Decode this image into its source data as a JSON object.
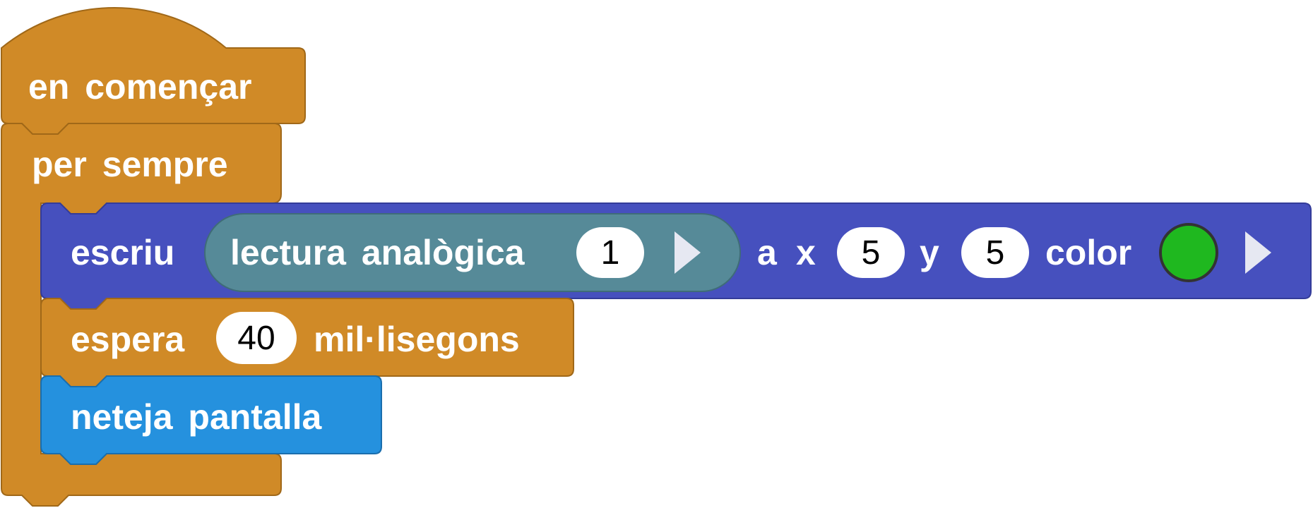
{
  "colors": {
    "event": "#D08A27",
    "event_stroke": "#A06818",
    "display": "#4650BE",
    "display_stroke": "#343C99",
    "analog": "#568A98",
    "analog_stroke": "#3F6C78",
    "clear": "#2591DE",
    "clear_stroke": "#1A6EAD",
    "color_value": "#1FB81F",
    "arrow": "#E6E8F2"
  },
  "blocks": {
    "on_start": {
      "label": "en començar"
    },
    "forever": {
      "label": "per sempre"
    },
    "show_number": {
      "label": "escriu",
      "reporter": {
        "label": "lectura analògica",
        "pin": "1"
      },
      "a_label": "a",
      "x_label": "x",
      "x_value": "5",
      "y_label": "y",
      "y_value": "5",
      "color_label": "color"
    },
    "pause": {
      "label": "espera",
      "value": "40",
      "unit": "mil·lisegons"
    },
    "clear_screen": {
      "label": "neteja pantalla"
    }
  }
}
